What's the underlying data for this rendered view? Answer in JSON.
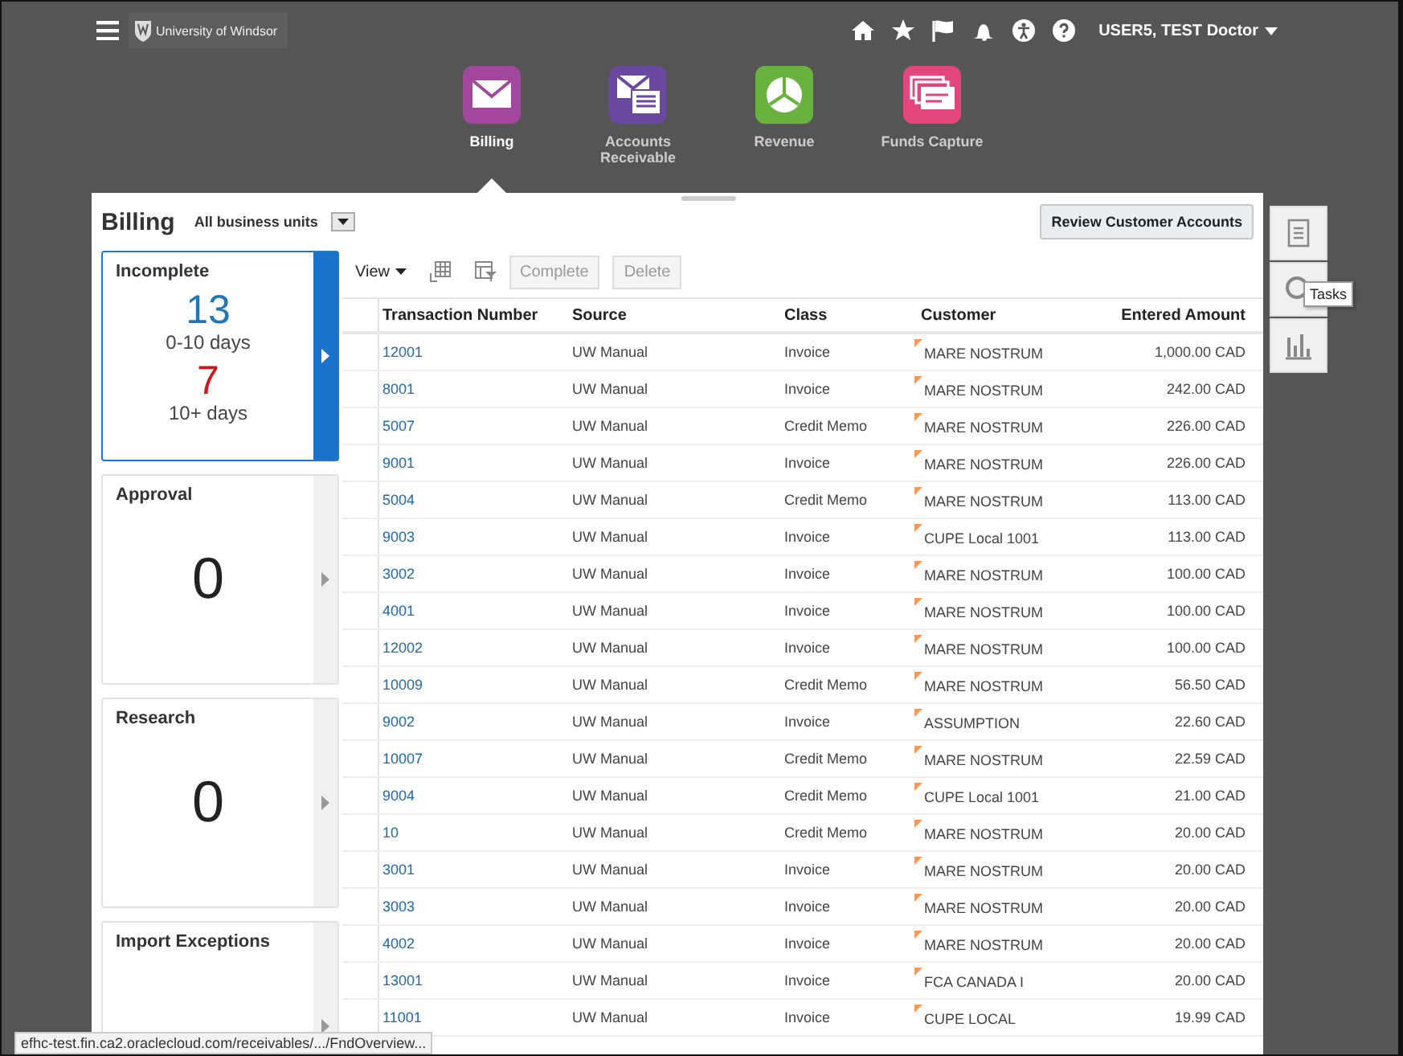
{
  "header": {
    "logo": "University of Windsor",
    "user": "USER5, TEST Doctor"
  },
  "apps": [
    {
      "label": "Billing",
      "kind": "envelope",
      "selected": true
    },
    {
      "label": "Accounts Receivable",
      "kind": "statement",
      "selected": false
    },
    {
      "label": "Revenue",
      "kind": "pie",
      "selected": false
    },
    {
      "label": "Funds Capture",
      "kind": "cards",
      "selected": false
    }
  ],
  "page": {
    "title": "Billing",
    "business_unit": "All business units",
    "action": "Review Customer Accounts"
  },
  "tiles": [
    {
      "title": "Incomplete",
      "selected": true,
      "counts": [
        {
          "value": "13",
          "label": "0-10 days",
          "color": "#1f77b8"
        },
        {
          "value": "7",
          "label": "10+ days",
          "color": "#d0161a"
        }
      ]
    },
    {
      "title": "Approval",
      "selected": false,
      "counts": [
        {
          "value": "0"
        }
      ]
    },
    {
      "title": "Research",
      "selected": false,
      "counts": [
        {
          "value": "0"
        }
      ]
    },
    {
      "title": "Import Exceptions",
      "selected": false
    }
  ],
  "toolbar": {
    "view": "View",
    "buttons": [
      {
        "label": "Complete",
        "disabled": true
      },
      {
        "label": "Delete",
        "disabled": true
      }
    ]
  },
  "table": {
    "columns": [
      "Transaction Number",
      "Source",
      "Class",
      "Customer",
      "Entered Amount"
    ],
    "rows": [
      {
        "number": "12001",
        "source": "UW Manual",
        "class": "Invoice",
        "customer": "MARE NOSTRUM",
        "amount": "1,000.00 CAD"
      },
      {
        "number": "8001",
        "source": "UW Manual",
        "class": "Invoice",
        "customer": "MARE NOSTRUM",
        "amount": "242.00 CAD"
      },
      {
        "number": "5007",
        "source": "UW Manual",
        "class": "Credit Memo",
        "customer": "MARE NOSTRUM",
        "amount": "226.00 CAD"
      },
      {
        "number": "9001",
        "source": "UW Manual",
        "class": "Invoice",
        "customer": "MARE NOSTRUM",
        "amount": "226.00 CAD"
      },
      {
        "number": "5004",
        "source": "UW Manual",
        "class": "Credit Memo",
        "customer": "MARE NOSTRUM",
        "amount": "113.00 CAD"
      },
      {
        "number": "9003",
        "source": "UW Manual",
        "class": "Invoice",
        "customer": "CUPE Local 1001",
        "amount": "113.00 CAD"
      },
      {
        "number": "3002",
        "source": "UW Manual",
        "class": "Invoice",
        "customer": "MARE NOSTRUM",
        "amount": "100.00 CAD"
      },
      {
        "number": "4001",
        "source": "UW Manual",
        "class": "Invoice",
        "customer": "MARE NOSTRUM",
        "amount": "100.00 CAD"
      },
      {
        "number": "12002",
        "source": "UW Manual",
        "class": "Invoice",
        "customer": "MARE NOSTRUM",
        "amount": "100.00 CAD"
      },
      {
        "number": "10009",
        "source": "UW Manual",
        "class": "Credit Memo",
        "customer": "MARE NOSTRUM",
        "amount": "56.50 CAD"
      },
      {
        "number": "9002",
        "source": "UW Manual",
        "class": "Invoice",
        "customer": "ASSUMPTION",
        "amount": "22.60 CAD"
      },
      {
        "number": "10007",
        "source": "UW Manual",
        "class": "Credit Memo",
        "customer": "MARE NOSTRUM",
        "amount": "22.59 CAD"
      },
      {
        "number": "9004",
        "source": "UW Manual",
        "class": "Credit Memo",
        "customer": "CUPE Local 1001",
        "amount": "21.00 CAD"
      },
      {
        "number": "10",
        "source": "UW Manual",
        "class": "Credit Memo",
        "customer": "MARE NOSTRUM",
        "amount": "20.00 CAD"
      },
      {
        "number": "3001",
        "source": "UW Manual",
        "class": "Invoice",
        "customer": "MARE NOSTRUM",
        "amount": "20.00 CAD"
      },
      {
        "number": "3003",
        "source": "UW Manual",
        "class": "Invoice",
        "customer": "MARE NOSTRUM",
        "amount": "20.00 CAD"
      },
      {
        "number": "4002",
        "source": "UW Manual",
        "class": "Invoice",
        "customer": "MARE NOSTRUM",
        "amount": "20.00 CAD"
      },
      {
        "number": "13001",
        "source": "UW Manual",
        "class": "Invoice",
        "customer": "FCA CANADA I",
        "amount": "20.00 CAD"
      },
      {
        "number": "11001",
        "source": "UW Manual",
        "class": "Invoice",
        "customer": "CUPE LOCAL",
        "amount": "19.99 CAD"
      }
    ]
  },
  "side_tabs": [
    {
      "kind": "document"
    },
    {
      "kind": "search",
      "tooltip": "Tasks"
    },
    {
      "kind": "chart"
    }
  ],
  "status_bar": "efhc-test.fin.ca2.oraclecloud.com/receivables/.../FndOverview..."
}
